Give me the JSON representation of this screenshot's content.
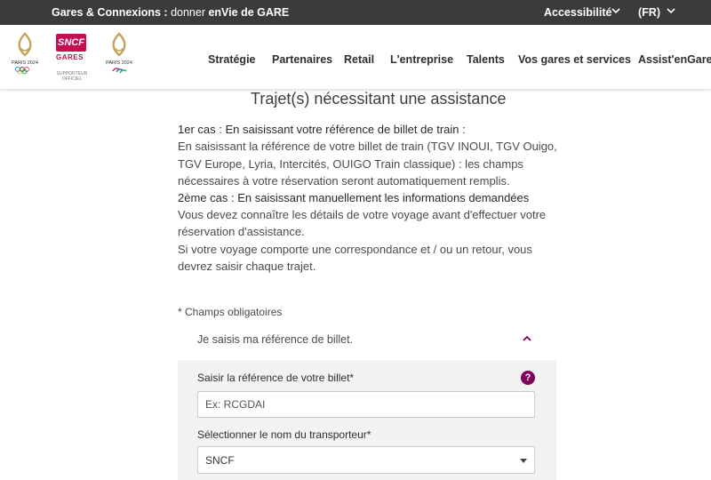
{
  "topbar": {
    "tag_bold": "Gares & Connexions :",
    "tag_normal": " donner ",
    "tag_bold2": "enVie de GARE",
    "accessibility": "Accessibilité",
    "lang": "(FR)"
  },
  "logos": {
    "paris2024": "PARIS 2024",
    "sncf": "SNCF",
    "gares": "GARES",
    "supporter": "SUPPORTEUR OFFICIEL"
  },
  "nav": [
    "Stratégie",
    "Partenaires",
    "Retail",
    "L'entreprise",
    "Talents",
    "Vos gares et services",
    "Assist'enGare"
  ],
  "page": {
    "title": "Trajet(s) nécessitant une assistance",
    "lines": [
      "1er cas : En saisissant votre référence de billet de train :",
      "En saisissant la référence de votre billet de train (TGV INOUI, TGV Ouigo,",
      "TGV Europe, Lyria, Intercités, OUIGO Train classique) : les champs",
      "nécessaires à votre réservation seront automatiquement remplis.",
      "2ème cas : En saisissant manuellement les informations demandées",
      "Vous devez connaître les détails de votre voyage avant d'effectuer votre",
      "réservation d'assistance.",
      "Si votre voyage comporte une correspondance et / ou un retour, vous",
      "devrez saisir chaque trajet."
    ],
    "required_note": "* Champs obligatoires"
  },
  "form": {
    "accordion_label": "Je saisis ma référence de billet.",
    "ticket_label": "Saisir la référence de votre billet*",
    "help": "?",
    "ticket_placeholder": "Ex: RCGDAI",
    "carrier_label": "Sélectionner le nom du transporteur*",
    "carrier_value": "SNCF"
  },
  "colors": {
    "accent": "#80005f",
    "sncf": "#c50d52",
    "paris_gold": "#c3a35a",
    "topbar": "#3b3b3b"
  }
}
